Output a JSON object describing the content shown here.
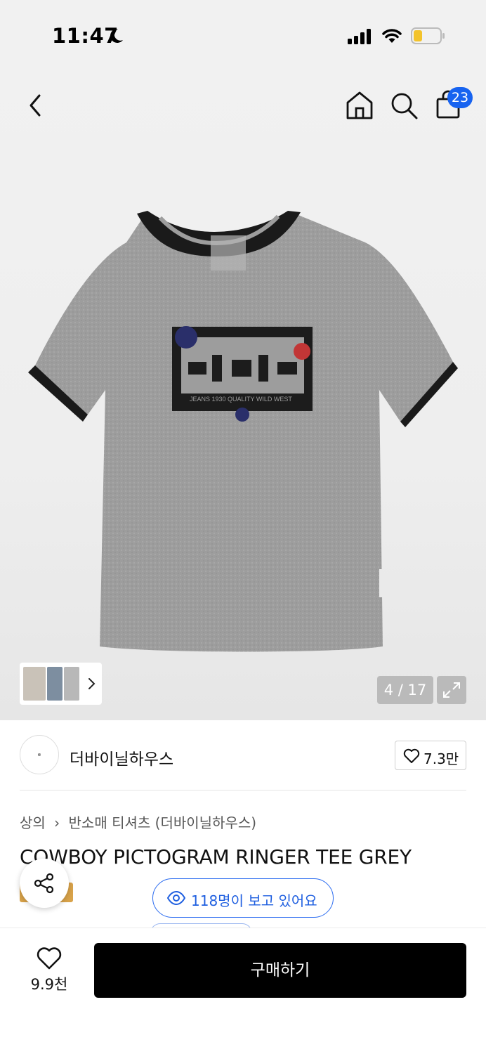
{
  "status_bar": {
    "time": "11:47",
    "icons": [
      "moon-icon",
      "signal-icon",
      "wifi-icon",
      "battery-icon"
    ],
    "battery_color": "#f3c32b"
  },
  "nav": {
    "icons": [
      "back-arrow-icon",
      "home-icon",
      "search-icon",
      "shopping-bag-icon"
    ],
    "cart_count": "23",
    "badge_color": "#1763f0"
  },
  "gallery": {
    "page_counter": "4 / 17",
    "expand_icon": "expand-icon",
    "thumbnail_arrow": "chevron-right-icon"
  },
  "brand": {
    "name": "더바이닐하우스",
    "logo_text": "© THEVINYLHOUSE",
    "like_count": "7.3만"
  },
  "product": {
    "breadcrumb": [
      "상의",
      "반소매 티셔츠 (더바이닐하우스)"
    ],
    "title": "COWBOY PICTOGRAM RINGER TEE GREY",
    "viewers": "118명이 보고 있어요",
    "accent_color": "#2b6cf0"
  },
  "bottom_bar": {
    "wish_count": "9.9천",
    "buy_label": "구매하기"
  }
}
